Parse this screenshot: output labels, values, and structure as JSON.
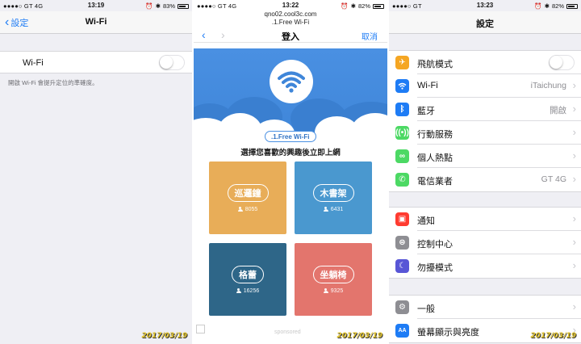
{
  "screen1": {
    "status": {
      "carrier": "●●●●○ GT  4G",
      "time": "13:19",
      "battery": "83%",
      "battery_level": 0.83
    },
    "back_label": "設定",
    "title": "Wi-Fi",
    "wifi_label": "Wi-Fi",
    "wifi_on": false,
    "hint": "開啟 Wi-Fi 會提升定位的準確度。",
    "date_stamp": "2017/03/19"
  },
  "screen2": {
    "status": {
      "carrier": "●●●●○ GT  4G",
      "time": "13:22",
      "battery": "82%",
      "battery_level": 0.82
    },
    "url_line1": "qno02.cool3c.com",
    "url_line2": ".1.Free Wi-Fi",
    "title": "登入",
    "cancel_label": "取消",
    "badge": ".1.Free Wi-Fi",
    "subtitle": "選擇您喜歡的興趣後立即上網",
    "tiles": [
      {
        "label": "巡邏鐘",
        "count": "8055",
        "color": "#e8ad58"
      },
      {
        "label": "木書架",
        "count": "6431",
        "color": "#4a98cf"
      },
      {
        "label": "格蕾",
        "count": "16256",
        "color": "#2e6688"
      },
      {
        "label": "坐躺椅",
        "count": "9325",
        "color": "#e3756d"
      }
    ],
    "sponsored": "sponsored",
    "date_stamp": "2017/03/19"
  },
  "screen3": {
    "status": {
      "carrier": "●●●●○ GT",
      "time": "13:23",
      "battery": "82%",
      "battery_level": 0.82
    },
    "title": "設定",
    "group1": [
      {
        "label": "飛航模式",
        "value": "",
        "icon": "airplane-icon",
        "color": "#f5a623",
        "toggle": true
      },
      {
        "label": "Wi-Fi",
        "value": "iTaichung",
        "icon": "wifi-icon",
        "color": "#1e7cf5"
      },
      {
        "label": "藍牙",
        "value": "開啟",
        "icon": "bluetooth-icon",
        "color": "#1e7cf5"
      },
      {
        "label": "行動服務",
        "value": "",
        "icon": "cellular-icon",
        "color": "#4cd964"
      },
      {
        "label": "個人熱點",
        "value": "",
        "icon": "hotspot-icon",
        "color": "#4cd964"
      },
      {
        "label": "電信業者",
        "value": "GT 4G",
        "icon": "phone-icon",
        "color": "#4cd964"
      }
    ],
    "group2": [
      {
        "label": "通知",
        "value": "",
        "icon": "notifications-icon",
        "color": "#ff3b30"
      },
      {
        "label": "控制中心",
        "value": "",
        "icon": "control-center-icon",
        "color": "#8e8e93"
      },
      {
        "label": "勿擾模式",
        "value": "",
        "icon": "moon-icon",
        "color": "#5856d6"
      }
    ],
    "group3": [
      {
        "label": "一般",
        "value": "",
        "icon": "gear-icon",
        "color": "#8e8e93"
      },
      {
        "label": "螢幕顯示與亮度",
        "value": "",
        "icon": "display-icon",
        "color": "#1e7cf5"
      }
    ],
    "date_stamp": "2017/03/19"
  }
}
